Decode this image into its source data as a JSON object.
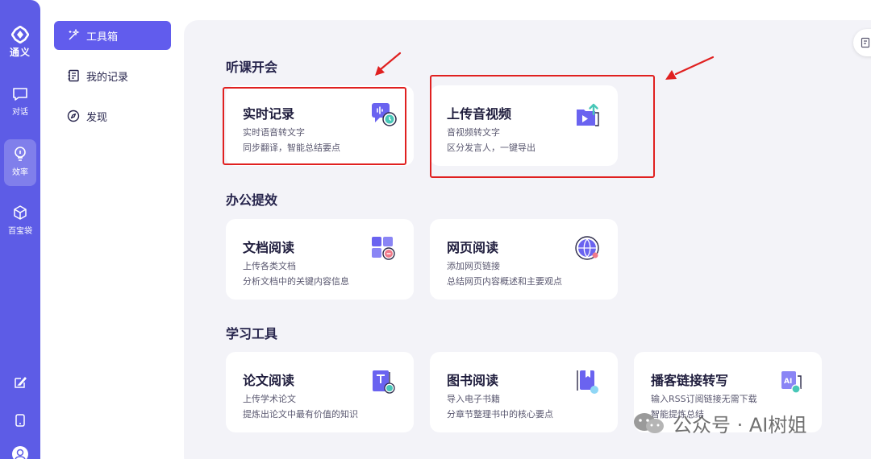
{
  "rail": {
    "logo_text": "通义",
    "items": [
      {
        "label": "对话",
        "icon": "chat-icon"
      },
      {
        "label": "效率",
        "icon": "bulb-icon"
      },
      {
        "label": "百宝袋",
        "icon": "cube-icon"
      }
    ],
    "bottom_icons": [
      "edit-icon",
      "tablet-icon",
      "user-icon"
    ]
  },
  "nav": {
    "items": [
      {
        "label": "工具箱",
        "icon": "magic-wand-icon",
        "active": true
      },
      {
        "label": "我的记录",
        "icon": "notebook-icon"
      },
      {
        "label": "发现",
        "icon": "compass-icon"
      }
    ]
  },
  "sections": [
    {
      "title": "听课开会",
      "cards": [
        {
          "title": "实时记录",
          "line1": "实时语音转文字",
          "line2": "同步翻译，智能总结要点",
          "icon": "live-record-icon"
        },
        {
          "title": "上传音视频",
          "line1": "音视频转文字",
          "line2": "区分发言人，一键导出",
          "icon": "upload-video-icon"
        }
      ]
    },
    {
      "title": "办公提效",
      "cards": [
        {
          "title": "文档阅读",
          "line1": "上传各类文档",
          "line2": "分析文档中的关键内容信息",
          "icon": "document-read-icon"
        },
        {
          "title": "网页阅读",
          "line1": "添加网页链接",
          "line2": "总结网页内容概述和主要观点",
          "icon": "globe-icon"
        }
      ]
    },
    {
      "title": "学习工具",
      "cards": [
        {
          "title": "论文阅读",
          "line1": "上传学术论文",
          "line2": "提炼出论文中最有价值的知识",
          "icon": "paper-icon"
        },
        {
          "title": "图书阅读",
          "line1": "导入电子书籍",
          "line2": "分章节整理书中的核心要点",
          "icon": "book-icon"
        },
        {
          "title": "播客链接转写",
          "line1": "输入RSS订阅链接无需下载",
          "line2": "智能提炼总结",
          "icon": "podcast-ai-icon"
        }
      ]
    }
  ],
  "watermark": {
    "text": "公众号 · AI树姐",
    "icon": "wechat-icon"
  },
  "colors": {
    "accent": "#5d5ce6",
    "nav_active": "#615ced",
    "panel": "#f3f3f8",
    "highlight": "#e02020"
  }
}
